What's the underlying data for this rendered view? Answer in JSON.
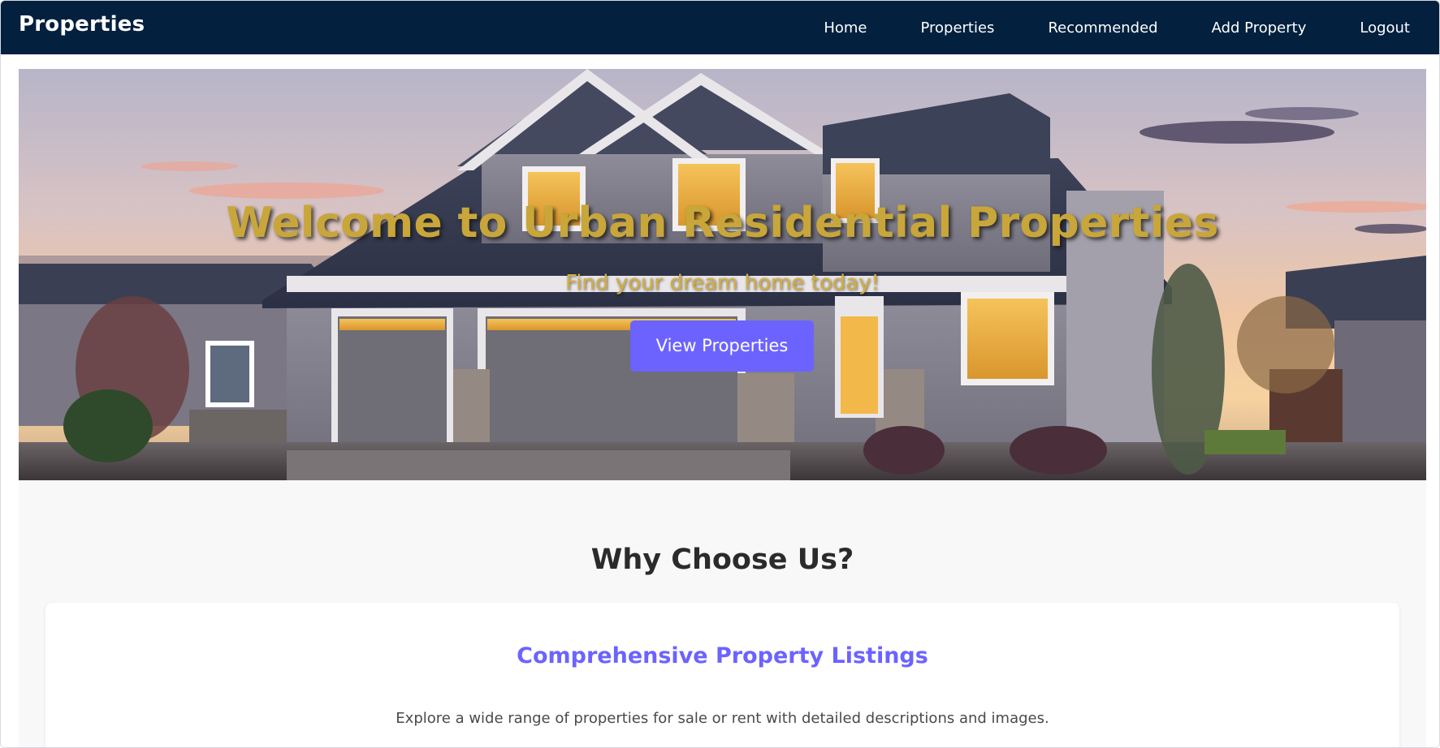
{
  "navbar": {
    "brand": "Properties",
    "links": [
      "Home",
      "Properties",
      "Recommended",
      "Add Property",
      "Logout"
    ],
    "background": "#03203f"
  },
  "hero": {
    "title": "Welcome to Urban Residential Properties",
    "subtitle": "Find your dream home today!",
    "button_label": "View Properties",
    "title_color": "#c8a63a",
    "button_color": "#6c63ff"
  },
  "why_section": {
    "title": "Why Choose Us?",
    "feature": {
      "title": "Comprehensive Property Listings",
      "description": "Explore a wide range of properties for sale or rent with detailed descriptions and images.",
      "title_color": "#6c63ff"
    }
  }
}
